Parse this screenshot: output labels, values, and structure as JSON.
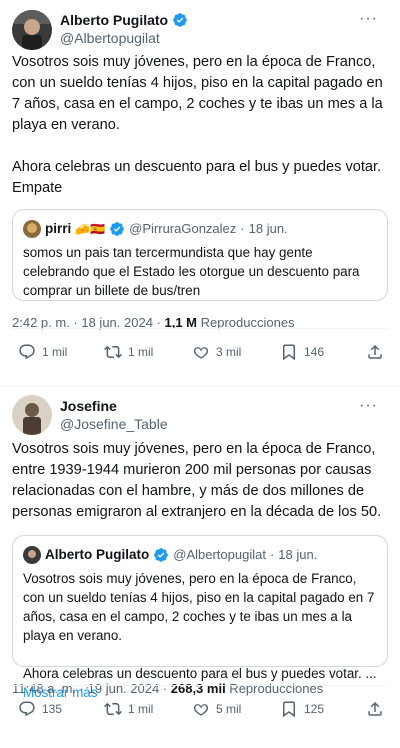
{
  "colors": {
    "text": "#0f1419",
    "secondary": "#536471",
    "link": "#1d9bf0",
    "border": "#cfd9de",
    "verified": "#1d9bf0"
  },
  "tweet1": {
    "display_name": "Alberto Pugilato",
    "handle": "@Albertopugilat",
    "more": "···",
    "text": "Vosotros sois muy jóvenes, pero en la época de Franco, con un sueldo tenías 4 hijos, piso en la capital pagado en 7 años, casa en el campo, 2 coches y te ibas un mes a la playa en verano.\n\nAhora celebras un descuento para el bus y puedes votar. Empate",
    "quote": {
      "display_name": "pirri",
      "emojis": "🧀🇪🇸",
      "handle": "@PirruraGonzalez",
      "dot": "·",
      "date": "18 jun.",
      "text": "somos un pais tan tercermundista que hay gente celebrando que el Estado les otorgue un descuento para comprar un billete de bus/tren"
    },
    "time": "2:42 p. m. · 18 jun. 2024 · ",
    "views": "1,1 M",
    "views_label": " Reproducciones",
    "replies": "1 mil",
    "retweets": "1 mil",
    "likes": "3 mil",
    "bookmarks": "146"
  },
  "tweet2": {
    "display_name": "Josefine",
    "handle": "@Josefine_Table",
    "more": "···",
    "text": "Vosotros sois muy jóvenes, pero en la época de Franco, entre 1939-1944 murieron 200 mil personas por causas relacionadas con el hambre, y más de dos millones de personas emigraron al extranjero en la década de los 50.",
    "quote": {
      "display_name": "Alberto Pugilato",
      "handle": "@Albertopugilat",
      "dot": "·",
      "date": "18 jun.",
      "text": "Vosotros sois muy jóvenes, pero en la época de Franco, con un sueldo tenías 4 hijos, piso en la capital pagado en 7 años, casa en el campo, 2 coches y te ibas un mes a la playa en verano.\n\nAhora celebras un descuento para el bus y puedes votar. ...",
      "show_more": "Mostrar más"
    },
    "time": "11:48 a. m. · 19 jun. 2024 · ",
    "views": "268,3 mil",
    "views_label": " Reproducciones",
    "replies": "135",
    "retweets": "1 mil",
    "likes": "5 mil",
    "bookmarks": "125"
  }
}
